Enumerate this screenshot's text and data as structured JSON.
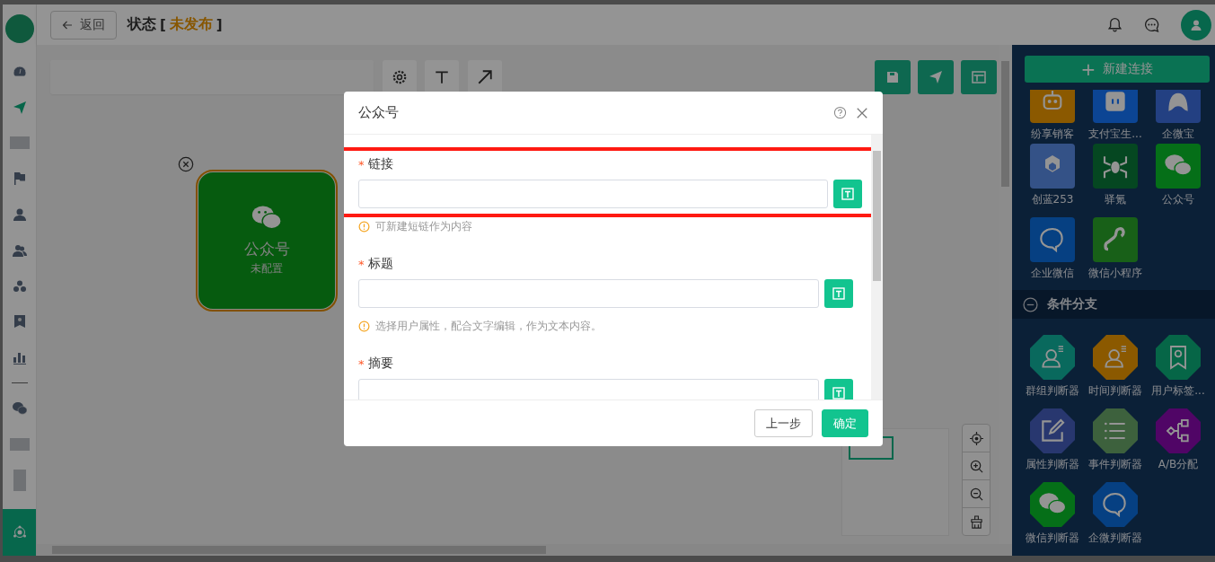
{
  "topbar": {
    "back_label": "返回",
    "title": "状态",
    "bracket_open": "[",
    "status": "未发布",
    "bracket_close": "]"
  },
  "sidebar": {
    "items": [
      {
        "kind": "dashboard",
        "selected": false
      },
      {
        "kind": "send",
        "selected": false
      },
      {
        "kind": "blurred",
        "selected": false
      },
      {
        "kind": "flag",
        "selected": false
      },
      {
        "kind": "user",
        "selected": false
      },
      {
        "kind": "users",
        "selected": false
      },
      {
        "kind": "cluster",
        "selected": false
      },
      {
        "kind": "badge",
        "selected": false
      },
      {
        "kind": "chart",
        "selected": false
      },
      {
        "kind": "divider"
      },
      {
        "kind": "wechat",
        "selected": false
      },
      {
        "kind": "blurred",
        "selected": false
      },
      {
        "kind": "blurred2",
        "selected": false
      },
      {
        "kind": "network",
        "selected": true
      }
    ]
  },
  "canvas": {
    "node": {
      "title": "公众号",
      "subtitle": "未配置",
      "selected": true
    }
  },
  "right_panel": {
    "new_button_icon": "+",
    "new_button": "新建连接",
    "connectors": [
      {
        "label": "纷享销客",
        "kind": "robot"
      },
      {
        "label": "支付宝生...",
        "kind": "square-face"
      },
      {
        "label": "企微宝",
        "kind": "ghost"
      },
      {
        "label": "创蓝253",
        "kind": "cube"
      },
      {
        "label": "驿氪",
        "kind": "spider"
      },
      {
        "label": "公众号",
        "kind": "wechat"
      },
      {
        "label": "企业微信",
        "kind": "bubble"
      },
      {
        "label": "微信小程序",
        "kind": "link"
      }
    ],
    "section_title": "条件分支",
    "branches": [
      {
        "label": "群组判断器",
        "kind": "group"
      },
      {
        "label": "时间判断器",
        "kind": "time"
      },
      {
        "label": "用户标签...",
        "kind": "badge"
      },
      {
        "label": "属性判断器",
        "kind": "edit"
      },
      {
        "label": "事件判断器",
        "kind": "list"
      },
      {
        "label": "A/B分配",
        "kind": "flow"
      },
      {
        "label": "微信判断器",
        "kind": "wechat"
      },
      {
        "label": "企微判断器",
        "kind": "bubble"
      }
    ]
  },
  "modal": {
    "title": "公众号",
    "fields": [
      {
        "required_mark": "*",
        "label": "链接",
        "highlighted": true,
        "hint": "可新建短链作为内容"
      },
      {
        "required_mark": "*",
        "label": "标题",
        "highlighted": false,
        "hint": "选择用户属性，配合文字编辑，作为文本内容。"
      },
      {
        "required_mark": "*",
        "label": "摘要",
        "highlighted": false
      }
    ],
    "buttons": [
      {
        "label": "上一步",
        "kind": "secondary"
      },
      {
        "label": "确定",
        "kind": "primary"
      }
    ]
  }
}
